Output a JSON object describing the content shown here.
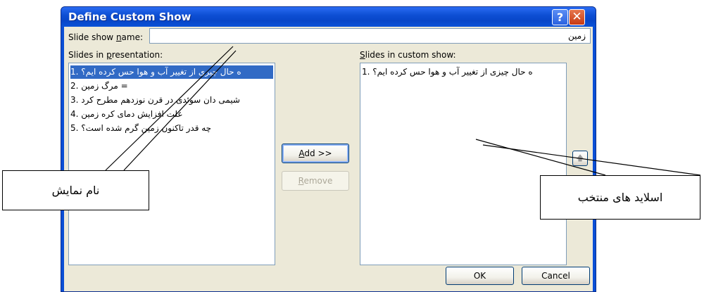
{
  "dialog": {
    "title": "Define Custom Show",
    "help_glyph": "?",
    "close_glyph": "✕"
  },
  "name_field": {
    "label_prefix": "Slide show ",
    "label_mnemonic": "n",
    "label_suffix": "ame:",
    "value": "زمین"
  },
  "presentation_list": {
    "label_prefix": "Slides in ",
    "label_mnemonic": "p",
    "label_suffix": "resentation:",
    "items": [
      "1. ه حال چیزی از تغییر آب و هوا حس کرده ایم؟",
      "2. مرگ زمین =",
      "3. شیمی دان سوئدی در قرن نوزدهم مطرح کرد",
      "4. علت افزایش دمای کره زمین",
      "5. چه قدر تاکنون زمین گرم شده است؟"
    ],
    "selected_index": 0
  },
  "custom_list": {
    "label_prefix": "",
    "label_mnemonic": "S",
    "label_suffix": "lides in custom show:",
    "items": [
      "1. ه حال چیزی از تغییر آب و هوا حس کرده ایم؟"
    ]
  },
  "buttons": {
    "add_mnemonic": "A",
    "add_rest": "dd >>",
    "remove_mnemonic": "R",
    "remove_rest": "emove",
    "move_up_glyph": "🡅",
    "ok": "OK",
    "cancel": "Cancel"
  },
  "callouts": {
    "show_name": "نام نمایش",
    "selected_slides": "اسلاید های منتخب"
  },
  "colors": {
    "titlebar": "#0a52d8",
    "client": "#ece9d8",
    "selection": "#316ac5"
  }
}
